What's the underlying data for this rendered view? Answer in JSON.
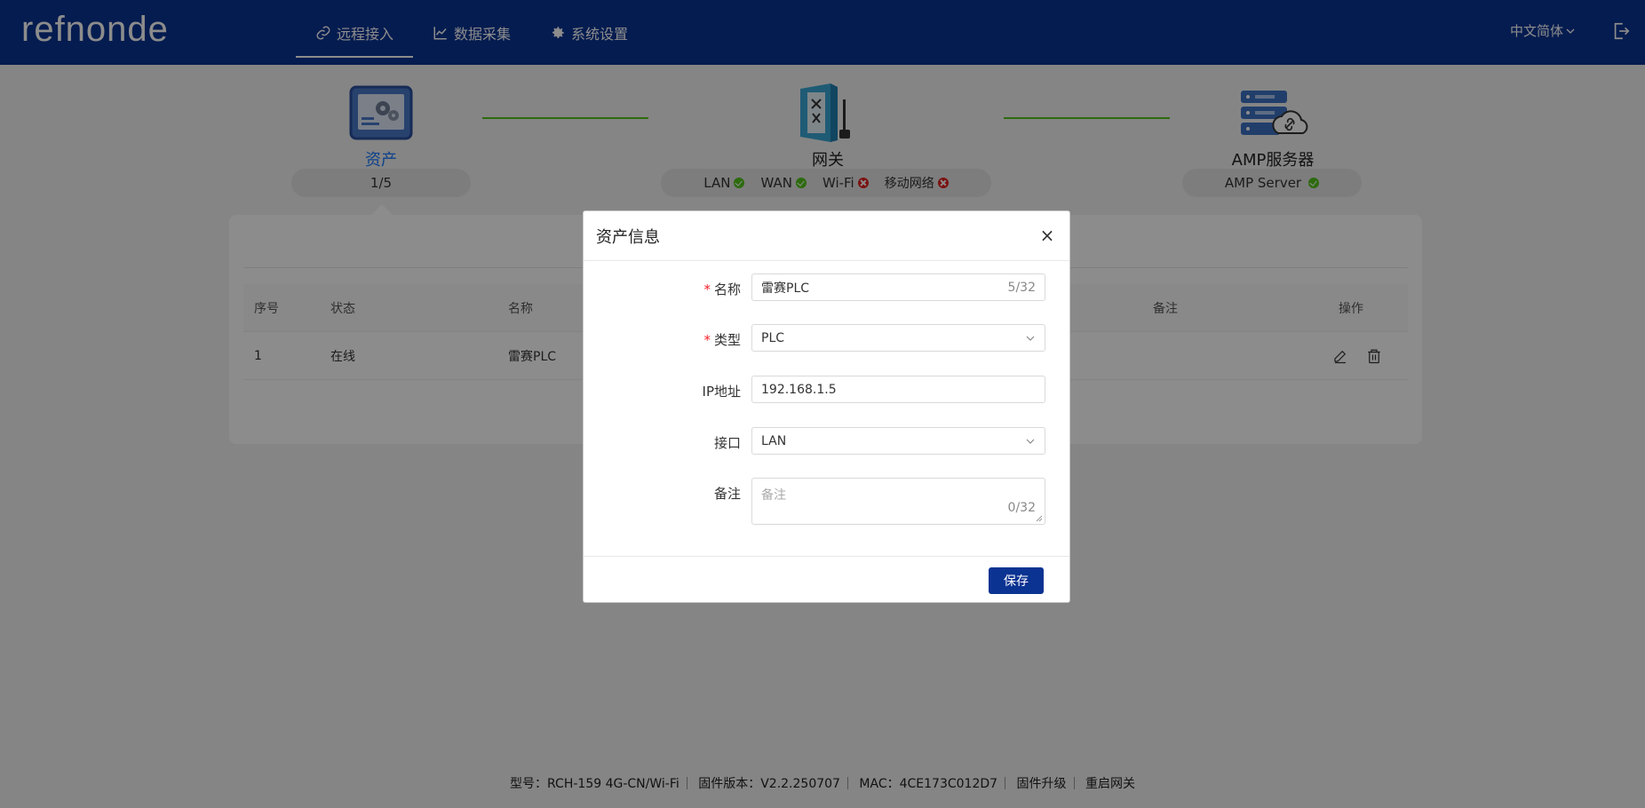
{
  "brand": {
    "logo_text": "refnonde"
  },
  "nav": [
    {
      "label": "远程接入",
      "icon": "link-icon",
      "active": true
    },
    {
      "label": "数据采集",
      "icon": "chart-icon",
      "active": false
    },
    {
      "label": "系统设置",
      "icon": "gear-icon",
      "active": false
    }
  ],
  "header": {
    "language": "中文简体"
  },
  "topology": {
    "asset": {
      "title": "资产",
      "count": "1/5"
    },
    "gateway": {
      "title": "网关",
      "statuses": [
        {
          "label": "LAN",
          "state": "ok"
        },
        {
          "label": "WAN",
          "state": "ok"
        },
        {
          "label": "Wi-Fi",
          "state": "error"
        },
        {
          "label": "移动网络",
          "state": "error"
        }
      ]
    },
    "server": {
      "title": "AMP服务器",
      "status_label": "AMP Server",
      "state": "ok"
    }
  },
  "table": {
    "columns": [
      "序号",
      "状态",
      "名称",
      "备注",
      "操作"
    ],
    "rows": [
      {
        "index": "1",
        "status": "在线",
        "name": "雷赛PLC",
        "remark": ""
      }
    ]
  },
  "modal": {
    "title": "资产信息",
    "fields": {
      "name": {
        "label": "名称",
        "required": true,
        "value": "雷赛PLC",
        "count": "5/32"
      },
      "type": {
        "label": "类型",
        "required": true,
        "value": "PLC"
      },
      "ip": {
        "label": "IP地址",
        "required": false,
        "value": "192.168.1.5"
      },
      "interface": {
        "label": "接口",
        "required": false,
        "value": "LAN"
      },
      "remark": {
        "label": "备注",
        "required": false,
        "placeholder": "备注",
        "count": "0/32"
      }
    },
    "save_label": "保存"
  },
  "footer": {
    "model": "型号：RCH-159  4G-CN/Wi-Fi",
    "firmware": "固件版本：V2.2.250707",
    "mac": "MAC：4CE173C012D7",
    "upgrade": "固件升级",
    "reboot": "重启网关"
  },
  "colors": {
    "brand_navy": "#0a3392",
    "ok_green": "#52c41a",
    "error_red": "#e02020",
    "active_blue": "#1677ff"
  }
}
